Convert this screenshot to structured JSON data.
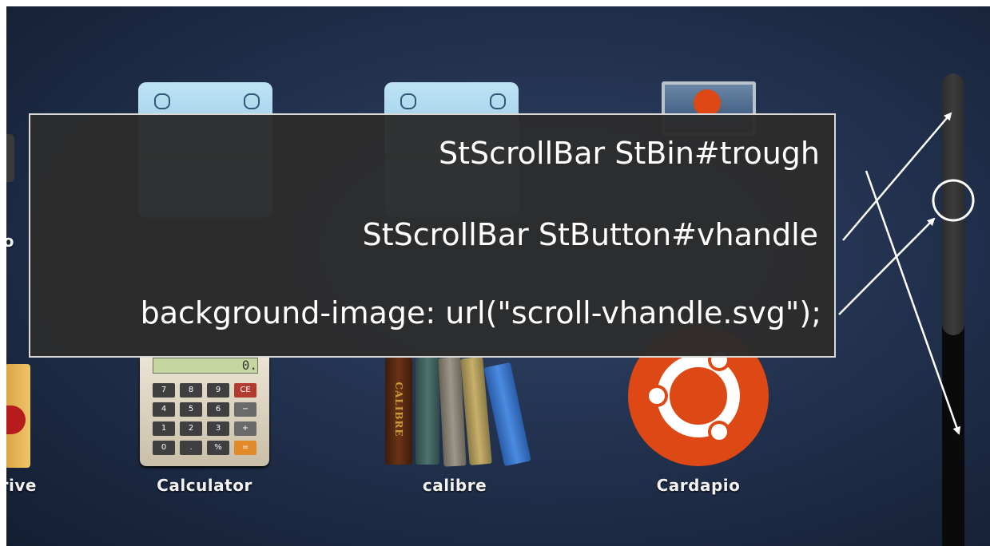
{
  "apps": [
    {
      "label": "co",
      "icon": "partial-app-icon"
    },
    {
      "label": "",
      "icon": "trophy-app-icon"
    },
    {
      "label": "",
      "icon": "app-icon"
    },
    {
      "label": "",
      "icon": "ubuntu-desktop-app-icon"
    },
    {
      "label": "rive",
      "icon": "drink-app-icon"
    },
    {
      "label": "Calculator",
      "icon": "calculator-icon"
    },
    {
      "label": "calibre",
      "icon": "calibre-books-icon"
    },
    {
      "label": "Cardapio",
      "icon": "ubuntu-logo-icon"
    }
  ],
  "calculator_keys": [
    "7",
    "8",
    "9",
    "CE",
    "4",
    "5",
    "6",
    "−",
    "1",
    "2",
    "3",
    "+",
    "0",
    ".",
    "%",
    "="
  ],
  "calculator_display": "0.",
  "calibre_spine_text": "CALIBRE",
  "annotation": {
    "lines": [
      "StScrollBar StBin#trough",
      "StScrollBar StButton#vhandle",
      "background-image: url(\"scroll-vhandle.svg\");"
    ]
  },
  "colors": {
    "background": "#22324f",
    "panel": "#2c2c2c",
    "panel_border": "#d9d9d9",
    "ubuntu_orange": "#dd4814",
    "trough": "#0a0a0a",
    "handle": "#3a3a3a"
  }
}
